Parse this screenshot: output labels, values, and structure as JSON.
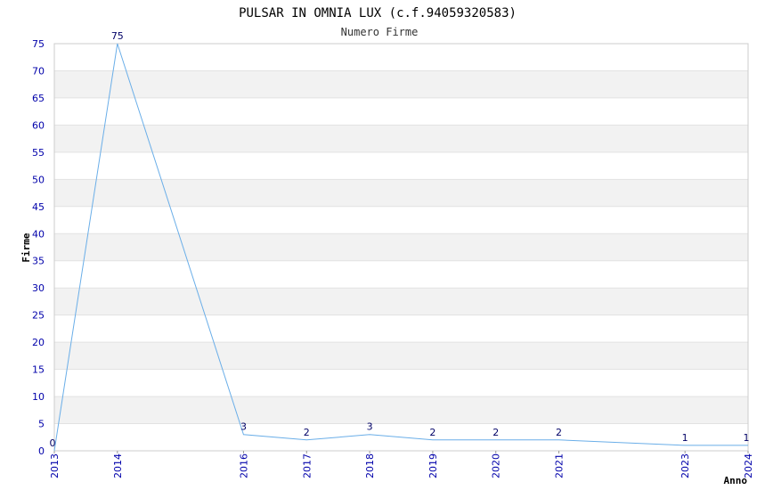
{
  "chart_data": {
    "type": "line",
    "title": "PULSAR IN OMNIA LUX (c.f.94059320583)",
    "subtitle": "Numero Firme",
    "xlabel": "Anno",
    "ylabel": "Firme",
    "x": [
      "2013",
      "2014",
      "2016",
      "2017",
      "2018",
      "2019",
      "2020",
      "2021",
      "2023",
      "2024"
    ],
    "values": [
      0,
      75,
      3,
      2,
      3,
      2,
      2,
      2,
      1,
      1
    ],
    "ylim": [
      0,
      75
    ],
    "yticks": [
      0,
      5,
      10,
      15,
      20,
      25,
      30,
      35,
      40,
      45,
      50,
      55,
      60,
      65,
      70,
      75
    ],
    "grid": true,
    "line_color": "#6aaee8",
    "band_color": "#f2f2f2",
    "tick_color": "#0000aa"
  }
}
